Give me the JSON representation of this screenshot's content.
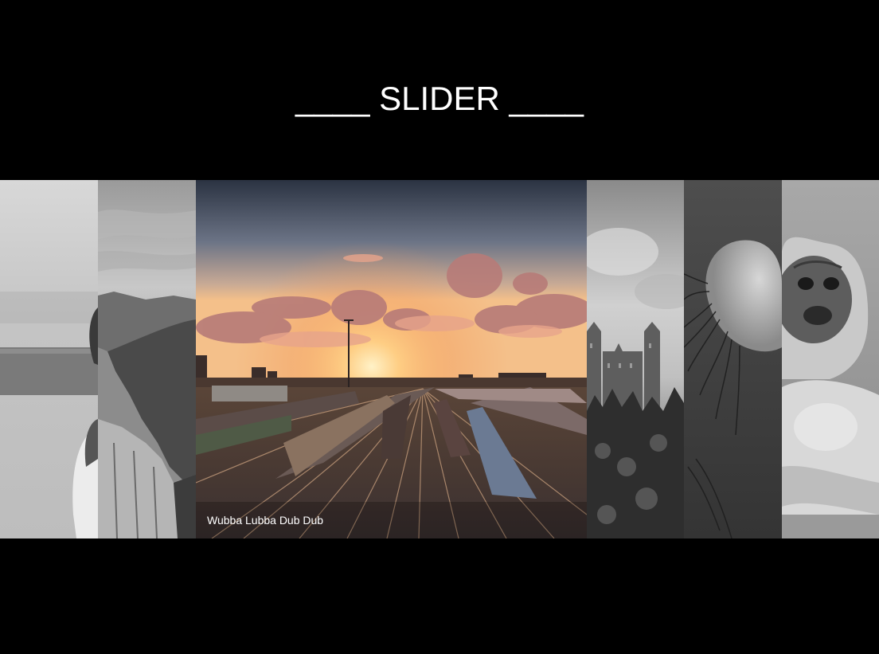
{
  "header": {
    "title": "____ SLIDER ____"
  },
  "slider": {
    "active_index": 2,
    "active_caption": "Wubba Lubba Dub Dub",
    "slides": [
      {
        "subject": "person-in-fog",
        "style": "grayscale",
        "active": false
      },
      {
        "subject": "cliff-over-fjord",
        "style": "grayscale",
        "active": false
      },
      {
        "subject": "railway-yard-sunset",
        "style": "color",
        "active": true
      },
      {
        "subject": "castle-on-hill",
        "style": "grayscale",
        "active": false
      },
      {
        "subject": "jellyfish",
        "style": "grayscale",
        "active": false
      },
      {
        "subject": "pug-in-hood",
        "style": "grayscale",
        "active": false
      }
    ]
  },
  "colors": {
    "background": "#000000",
    "text": "#ffffff",
    "sunset_glow": "#ffb35c",
    "sky_top": "#2b3342"
  }
}
